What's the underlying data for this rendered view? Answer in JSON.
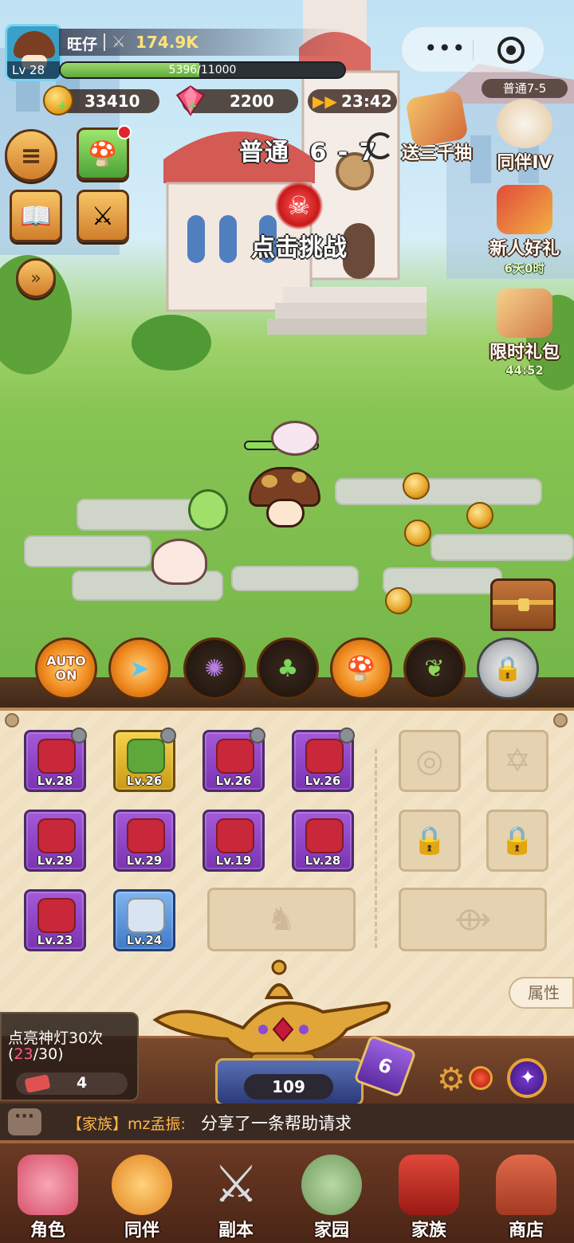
{
  "player": {
    "name": "旺仔",
    "level_label": "Lv 28",
    "power": "174.9K",
    "xp_text": "5396/11000",
    "xp_fraction": 0.49
  },
  "resources": {
    "gold": "33410",
    "gems": "2200",
    "speed_timer": "23:42"
  },
  "stage": {
    "label": "普通",
    "number": "6 - 7",
    "challenge_label": "点击挑战"
  },
  "right_events": {
    "stage_tag": "普通7-5",
    "items": [
      {
        "label": "送三千抽",
        "sub": ""
      },
      {
        "label": "同伴IV",
        "sub": ""
      },
      {
        "label": "新人好礼",
        "sub": "6天0时"
      },
      {
        "label": "限时礼包",
        "sub": "44:52"
      }
    ]
  },
  "skills": {
    "auto_line1": "AUTO",
    "auto_line2": "ON"
  },
  "equipment": [
    {
      "level": "Lv.28",
      "rarity": "purple",
      "icon": "pig-icon"
    },
    {
      "level": "Lv.26",
      "rarity": "gold",
      "icon": "vine-wreath-icon"
    },
    {
      "level": "Lv.26",
      "rarity": "purple",
      "icon": "goggles-icon"
    },
    {
      "level": "Lv.26",
      "rarity": "purple",
      "icon": "helmet-icon"
    },
    {
      "level": "Lv.29",
      "rarity": "purple",
      "icon": "mask-icon"
    },
    {
      "level": "Lv.29",
      "rarity": "purple",
      "icon": "boot-icon"
    },
    {
      "level": "Lv.19",
      "rarity": "purple",
      "icon": "armor-icon"
    },
    {
      "level": "Lv.28",
      "rarity": "purple",
      "icon": "belt-icon"
    },
    {
      "level": "Lv.23",
      "rarity": "purple",
      "icon": "gauntlet-icon"
    },
    {
      "level": "Lv.24",
      "rarity": "blue",
      "icon": "gloves-icon"
    }
  ],
  "attr_tab": "属性",
  "lamp": {
    "count": "109",
    "card_number": "6"
  },
  "quest": {
    "title": "点亮神灯30次",
    "progress_open": "(",
    "progress_current": "23",
    "progress_total": "/30)",
    "ticket_count": "4"
  },
  "chat": {
    "tag": "【家族】mz孟振:",
    "message": "分享了一条帮助请求"
  },
  "nav": [
    {
      "label": "角色",
      "icon": "pig-hero-icon"
    },
    {
      "label": "同伴",
      "icon": "paw-icon"
    },
    {
      "label": "副本",
      "icon": "crossed-swords-icon"
    },
    {
      "label": "家园",
      "icon": "home-garden-icon"
    },
    {
      "label": "家族",
      "icon": "clan-banner-icon"
    },
    {
      "label": "商店",
      "icon": "shop-icon"
    }
  ]
}
